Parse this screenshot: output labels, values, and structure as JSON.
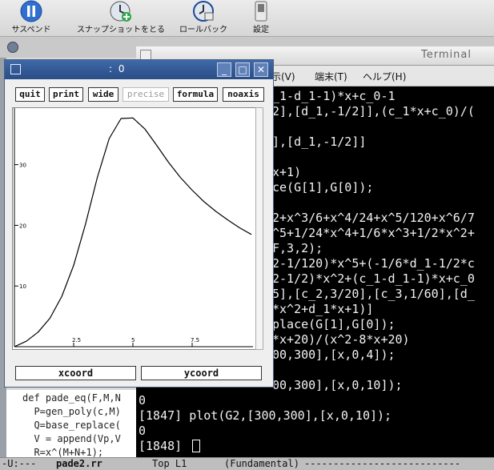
{
  "vm_toolbar": {
    "suspend": "サスペンド",
    "snapshot": "スナップショットをとる",
    "rollback": "ロールバック",
    "settings": "設定"
  },
  "terminal": {
    "title": "Terminal",
    "menu_partial": "示(V)",
    "menu_terminal": "端末(T)",
    "menu_help": "ヘルプ(H)",
    "lines": [
      "_1-d_1-1)*x+c_0-1",
      "2],[d_1,-1/2]],(c_1*x+c_0)/(",
      "",
      "],[d_1,-1/2]]",
      "",
      "x+1)",
      "ce(G[1],G[0]);",
      "",
      "2+x^3/6+x^4/24+x^5/120+x^6/7",
      "^5+1/24*x^4+1/6*x^3+1/2*x^2+",
      "F,3,2);",
      "2-1/120)*x^5+(-1/6*d_1-1/2*c",
      "2-1/2)*x^2+(c_1-d_1-1)*x+c_0",
      "5],[c_2,3/20],[c_3,1/60],[d_",
      "*x^2+d_1*x+1)]",
      "place(G[1],G[0]);",
      "*x+20)/(x^2-8*x+20)",
      "00,300],[x,0,4]);",
      "",
      "00,300],[x,0,10]);"
    ],
    "full_lines": [
      "0",
      "[1847] plot(G2,[300,300],[x,0,10]);",
      "0",
      "[1848] "
    ]
  },
  "emacs": {
    "code": [
      "def pade_eq(F,M,N",
      "  P=gen_poly(c,M)",
      "  Q=base_replace(",
      "  V = append(Vp,V",
      "  R=x^(M+N+1);"
    ],
    "modeline": {
      "status": "-U:---",
      "buffer": "pade2.rr",
      "position": "Top L1",
      "mode": "(Fundamental)",
      "fill": "---------------------------"
    }
  },
  "plot_window": {
    "title": ": 0",
    "buttons": {
      "quit": "quit",
      "print": "print",
      "wide": "wide",
      "precise": "precise",
      "formula": "formula",
      "noaxis": "noaxis"
    },
    "xcoord": "xcoord",
    "ycoord": "ycoord"
  },
  "chart_data": {
    "type": "line",
    "x_range": [
      0,
      10
    ],
    "y_range": [
      0,
      38
    ],
    "x_ticks": [
      "2.5",
      "5",
      "7.5"
    ],
    "y_ticks": [
      "10",
      "20",
      "30"
    ],
    "series": [
      {
        "x": [
          0,
          0.5,
          1,
          1.5,
          2,
          2.5,
          3,
          3.5,
          4,
          4.5,
          5,
          5.5,
          6,
          6.5,
          7,
          7.5,
          8,
          8.5,
          9,
          9.5,
          10
        ],
        "y": [
          0,
          0.9,
          2.4,
          4.7,
          8.3,
          13.4,
          20.2,
          27.9,
          34.3,
          37.6,
          37.7,
          35.9,
          33.2,
          30.4,
          27.9,
          25.8,
          23.9,
          22.3,
          20.9,
          19.6,
          18.5
        ]
      }
    ]
  }
}
